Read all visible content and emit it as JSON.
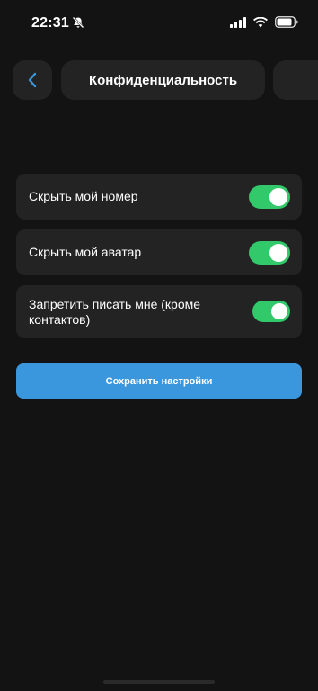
{
  "status_bar": {
    "time": "22:31",
    "icons": [
      "bell-slash-icon",
      "signal-icon",
      "wifi-icon",
      "battery-icon"
    ]
  },
  "header": {
    "back_icon": "chevron-left-icon",
    "title": "Конфиденциальность"
  },
  "settings": [
    {
      "label": "Скрыть мой номер",
      "enabled": true
    },
    {
      "label": "Скрыть мой аватар",
      "enabled": true
    },
    {
      "label": "Запретить писать мне (кроме контактов)",
      "enabled": true
    }
  ],
  "save_button": {
    "label": "Сохранить настройки"
  },
  "colors": {
    "background": "#131313",
    "card": "#232323",
    "toggle_on": "#31c969",
    "accent": "#3a97de",
    "back_chevron": "#3a97de"
  }
}
